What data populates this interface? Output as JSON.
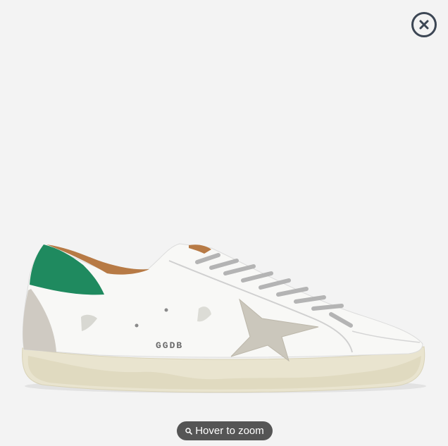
{
  "viewer": {
    "close_icon": "close-icon",
    "zoom_hint": "Hover to zoom",
    "zoom_icon": "magnifier-icon",
    "image_logo_text": "GGDB",
    "colors": {
      "background": "#f3f3f3",
      "close_icon": "#3c4654",
      "heel_tab": "#1f8a5f",
      "pill_bg": "#555555"
    }
  }
}
